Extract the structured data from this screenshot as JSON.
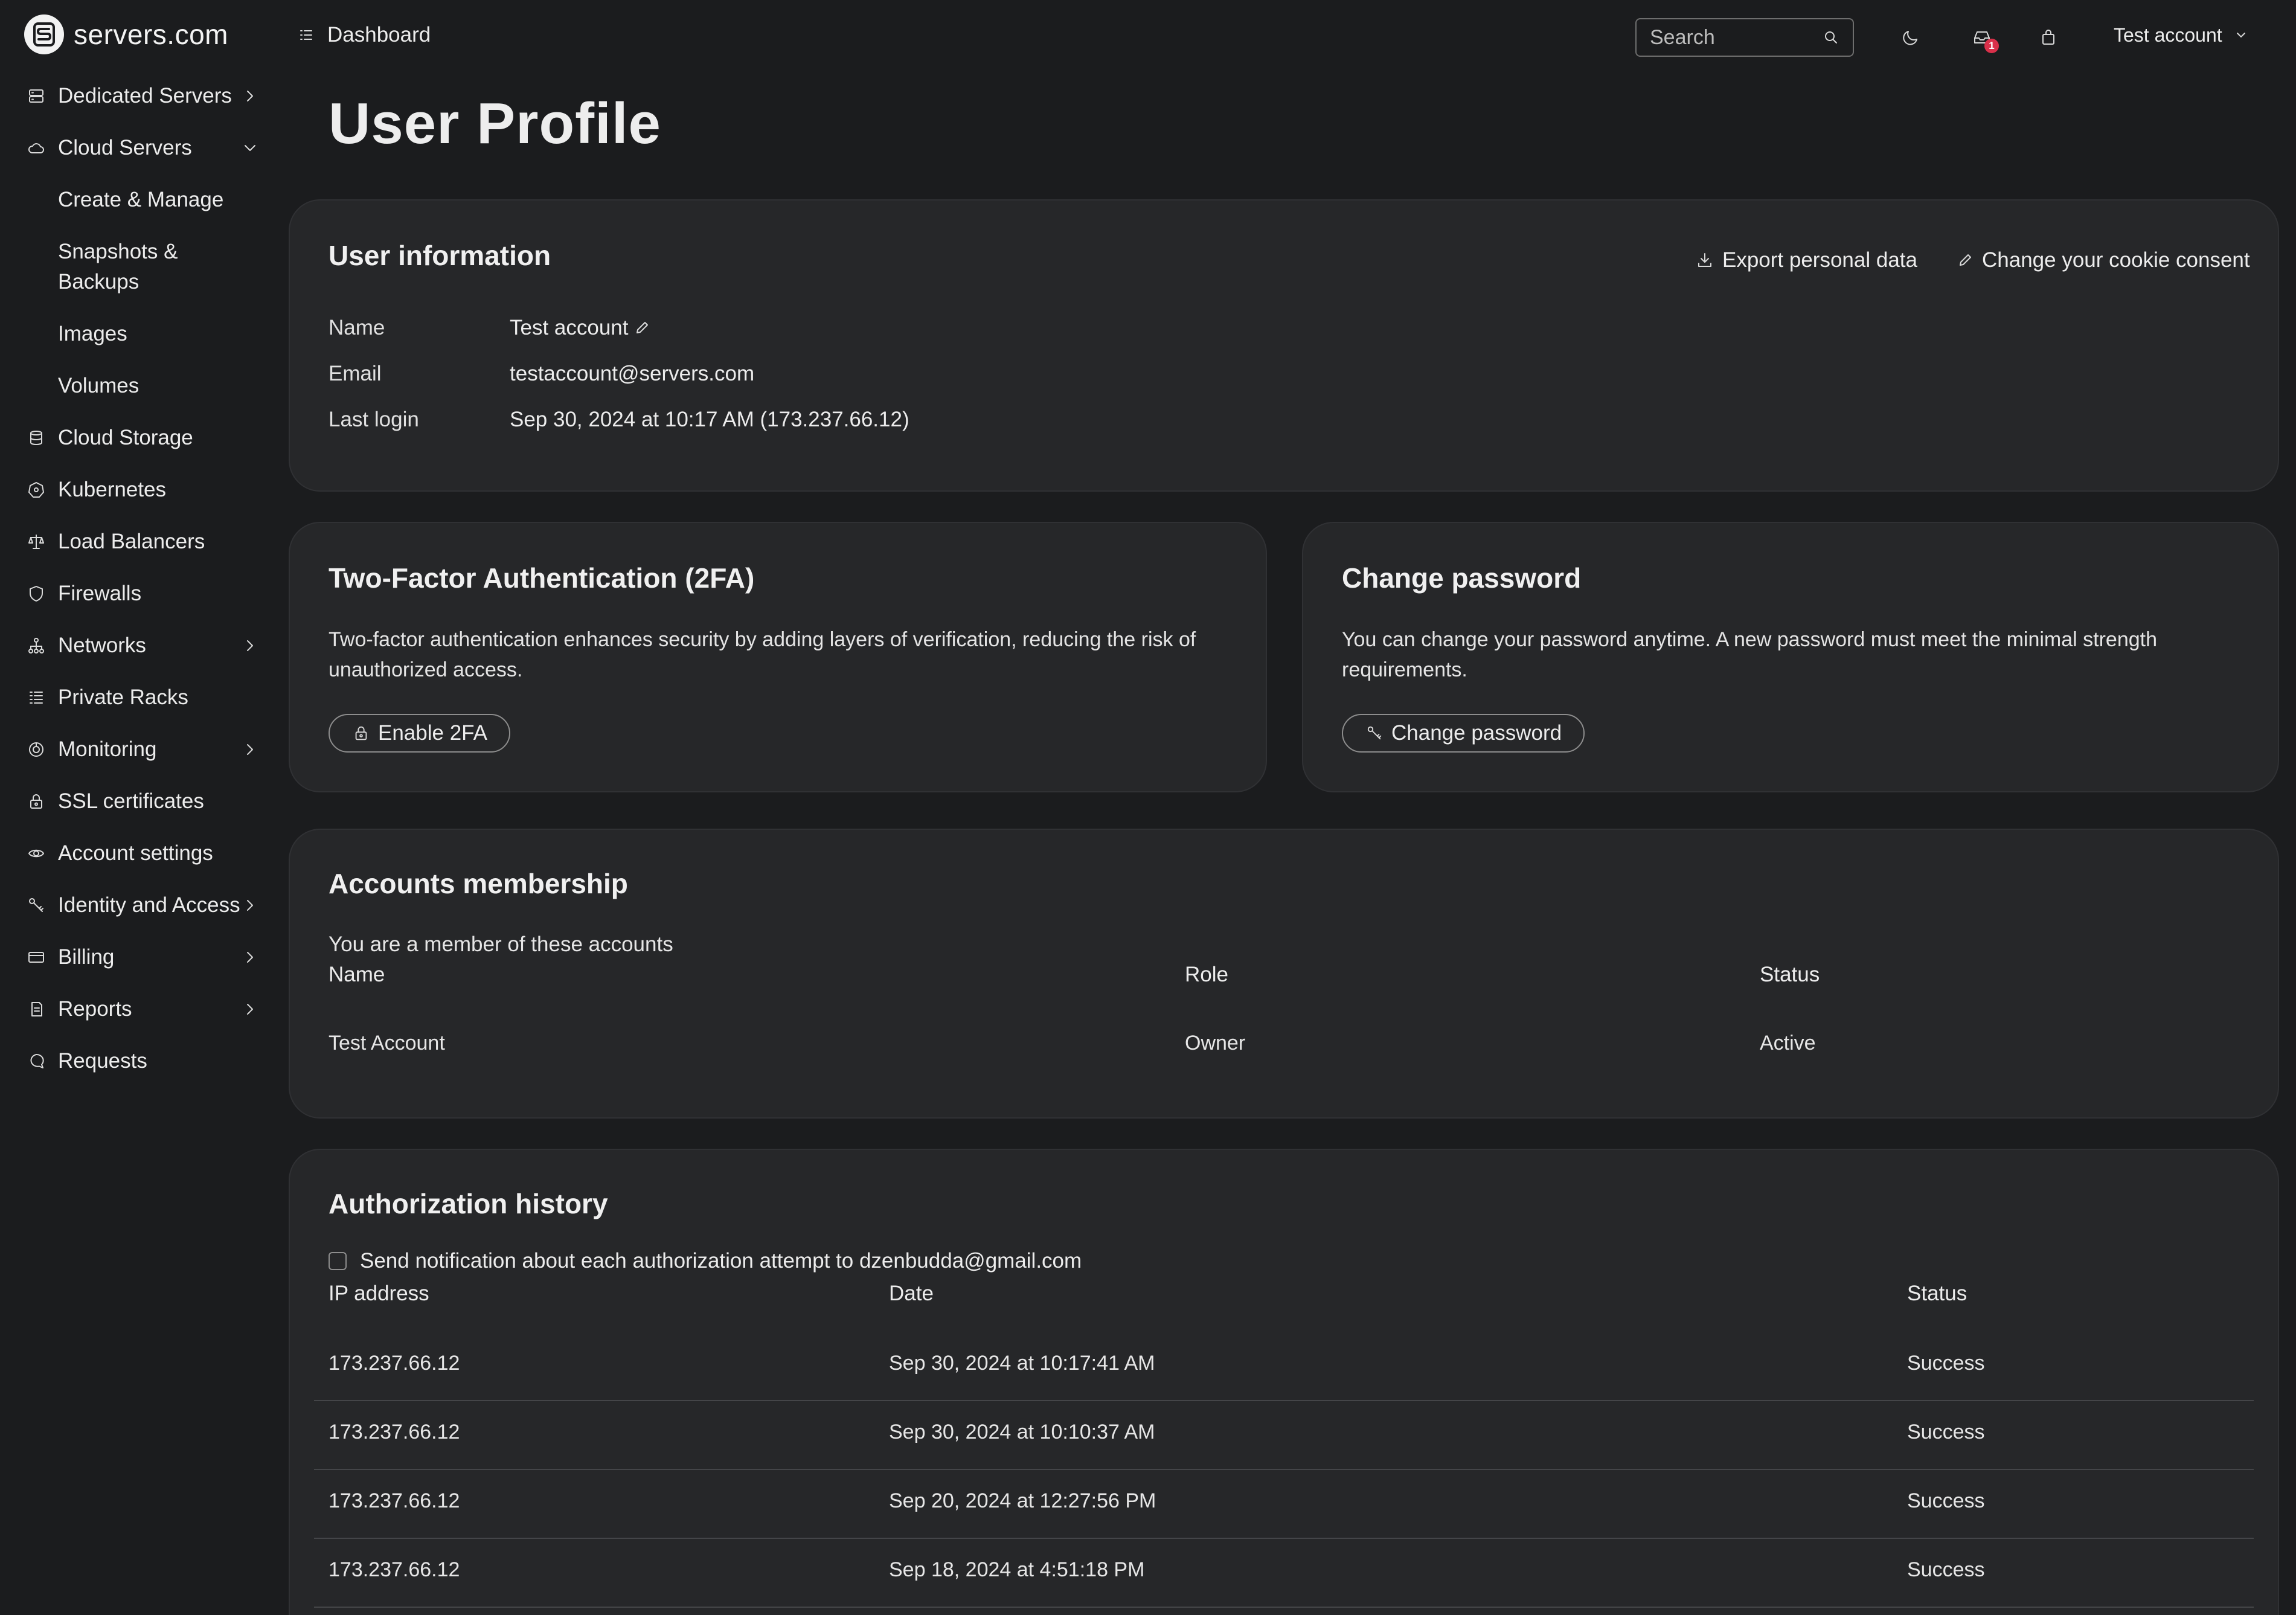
{
  "brand": {
    "name": "servers.com"
  },
  "topbar": {
    "dashboard_label": "Dashboard",
    "search_placeholder": "Search",
    "notification_count": "1",
    "account_label": "Test account"
  },
  "sidebar": {
    "items": [
      {
        "label": "Dedicated Servers",
        "icon": "server-icon",
        "chevron": "right"
      },
      {
        "label": "Cloud Servers",
        "icon": "cloud-icon",
        "chevron": "down",
        "children": [
          "Create & Manage",
          "Snapshots & Backups",
          "Images",
          "Volumes"
        ]
      },
      {
        "label": "Cloud Storage",
        "icon": "database-icon"
      },
      {
        "label": "Kubernetes",
        "icon": "kubernetes-icon"
      },
      {
        "label": "Load Balancers",
        "icon": "scale-icon"
      },
      {
        "label": "Firewalls",
        "icon": "shield-icon"
      },
      {
        "label": "Networks",
        "icon": "network-icon",
        "chevron": "right"
      },
      {
        "label": "Private Racks",
        "icon": "rack-icon"
      },
      {
        "label": "Monitoring",
        "icon": "monitoring-icon",
        "chevron": "right"
      },
      {
        "label": "SSL certificates",
        "icon": "lock-icon"
      },
      {
        "label": "Account settings",
        "icon": "eye-icon"
      },
      {
        "label": "Identity and Access",
        "icon": "key-icon",
        "chevron": "right"
      },
      {
        "label": "Billing",
        "icon": "card-icon",
        "chevron": "right"
      },
      {
        "label": "Reports",
        "icon": "report-icon",
        "chevron": "right"
      },
      {
        "label": "Requests",
        "icon": "chat-icon"
      }
    ]
  },
  "page": {
    "title": "User Profile"
  },
  "user_info": {
    "title": "User information",
    "export_label": "Export personal data",
    "cookie_label": "Change your cookie consent",
    "rows": [
      {
        "key": "Name",
        "value": "Test account"
      },
      {
        "key": "Email",
        "value": "testaccount@servers.com"
      },
      {
        "key": "Last login",
        "value": "Sep 30, 2024 at 10:17 AM (173.237.66.12)"
      }
    ]
  },
  "twofa": {
    "title": "Two-Factor Authentication (2FA)",
    "description": "Two-factor authentication enhances security by adding layers of verification, reducing the risk of unauthorized access.",
    "button_label": "Enable 2FA"
  },
  "password": {
    "title": "Change password",
    "description": "You can change your password anytime. A new password must meet the minimal strength requirements.",
    "button_label": "Change password"
  },
  "membership": {
    "title": "Accounts membership",
    "subtitle": "You are a member of these accounts",
    "columns": [
      "Name",
      "Role",
      "Status"
    ],
    "rows": [
      {
        "name": "Test Account",
        "role": "Owner",
        "status": "Active"
      }
    ]
  },
  "auth_history": {
    "title": "Authorization history",
    "notify_label": "Send notification about each authorization attempt to dzenbudda@gmail.com",
    "columns": [
      "IP address",
      "Date",
      "Status"
    ],
    "rows": [
      {
        "ip": "173.237.66.12",
        "date": "Sep 30, 2024 at 10:17:41 AM",
        "status": "Success"
      },
      {
        "ip": "173.237.66.12",
        "date": "Sep 30, 2024 at 10:10:37 AM",
        "status": "Success"
      },
      {
        "ip": "173.237.66.12",
        "date": "Sep 20, 2024 at 12:27:56 PM",
        "status": "Success"
      },
      {
        "ip": "173.237.66.12",
        "date": "Sep 18, 2024 at 4:51:18 PM",
        "status": "Success"
      }
    ]
  },
  "colors": {
    "background": "#1b1c1e",
    "card": "#262729",
    "text": "#e6e6e6",
    "badge": "#d9304a"
  }
}
